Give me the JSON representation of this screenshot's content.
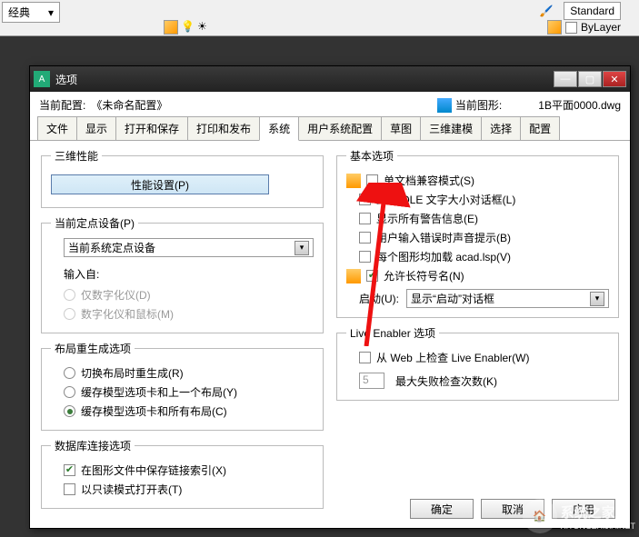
{
  "background": {
    "layer_dropdown": "经典",
    "standard_label": "Standard",
    "bylayer_label": "ByLayer"
  },
  "dialog": {
    "title": "选项",
    "header": {
      "current_profile_label": "当前配置:",
      "current_profile_value": "《未命名配置》",
      "current_drawing_label": "当前图形:",
      "current_drawing_value": "1B平面0000.dwg"
    },
    "tabs": [
      "文件",
      "显示",
      "打开和保存",
      "打印和发布",
      "系统",
      "用户系统配置",
      "草图",
      "三维建模",
      "选择",
      "配置"
    ],
    "active_tab_index": 4,
    "left": {
      "perf_group": "三维性能",
      "perf_button": "性能设置(P)",
      "pointing_group": "当前定点设备(P)",
      "pointing_value": "当前系统定点设备",
      "input_from": "输入自:",
      "radio_digitizer": "仅数字化仪(D)",
      "radio_both": "数字化仪和鼠标(M)",
      "regen_group": "布局重生成选项",
      "regen_r1": "切换布局时重生成(R)",
      "regen_r2": "缓存模型选项卡和上一个布局(Y)",
      "regen_r3": "缓存模型选项卡和所有布局(C)",
      "db_group": "数据库连接选项",
      "db_c1": "在图形文件中保存链接索引(X)",
      "db_c2": "以只读模式打开表(T)"
    },
    "right": {
      "basic_group": "基本选项",
      "c_sdi": "单文档兼容模式(S)",
      "c_ole": "显示 OLE 文字大小对话框(L)",
      "c_alerts": "显示所有警告信息(E)",
      "c_beep": "用户输入错误时声音提示(B)",
      "c_acadlsp": "每个图形均加载 acad.lsp(V)",
      "c_longnames": "允许长符号名(N)",
      "launch_label": "启动(U):",
      "launch_value": "显示“启动”对话框",
      "live_group": "Live Enabler 选项",
      "live_check": "从 Web 上检查 Live Enabler(W)",
      "live_input": "5",
      "live_fail_label": "最大失败检查次数(K)"
    },
    "buttons": {
      "ok": "确定",
      "cancel": "取消",
      "apply": "应用"
    }
  },
  "watermark": {
    "text": "系统之家",
    "url": "XITONGZHIJIA.NET"
  }
}
